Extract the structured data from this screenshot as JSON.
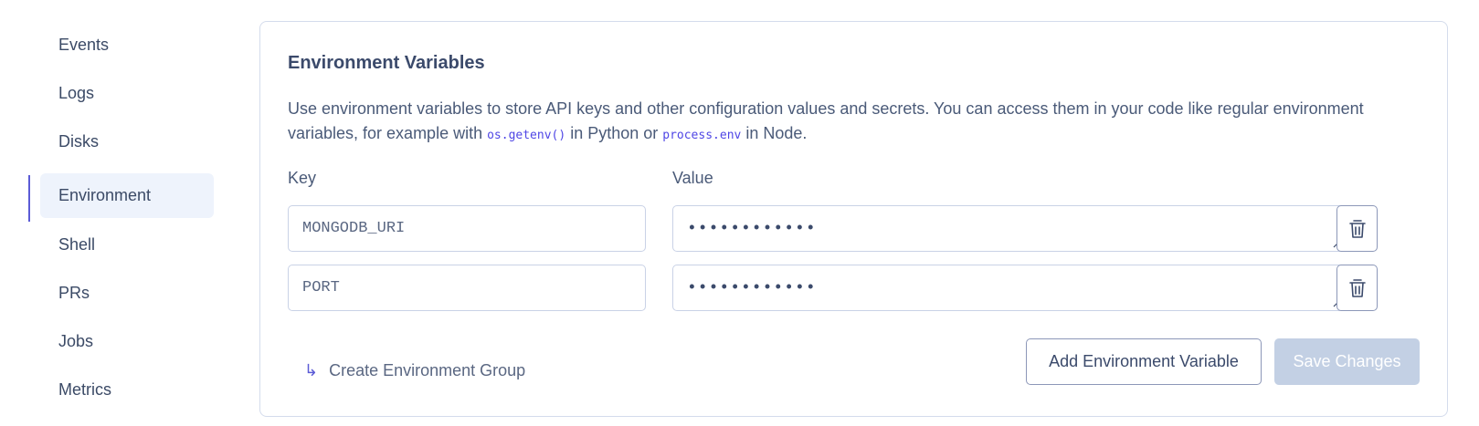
{
  "sidebar": {
    "items": [
      {
        "label": "Events"
      },
      {
        "label": "Logs"
      },
      {
        "label": "Disks"
      },
      {
        "label": "Environment",
        "active": true
      },
      {
        "label": "Shell"
      },
      {
        "label": "PRs"
      },
      {
        "label": "Jobs"
      },
      {
        "label": "Metrics"
      }
    ]
  },
  "env": {
    "title": "Environment Variables",
    "desc_part1": "Use environment variables to store API keys and other configuration values and secrets. You can access them in your code like regular environment variables, for example with ",
    "code1": "os.getenv()",
    "desc_part2": " in Python or ",
    "code2": "process.env",
    "desc_part3": " in Node.",
    "key_label": "Key",
    "value_label": "Value",
    "rows": [
      {
        "key": "MONGODB_URI",
        "value": "••••••••••••"
      },
      {
        "key": "PORT",
        "value": "••••••••••••"
      }
    ],
    "create_group_label": "Create Environment Group",
    "add_label": "Add Environment Variable",
    "save_label": "Save Changes"
  },
  "colors": {
    "accent": "#5b5bd6",
    "active_bg": "#eef3fc",
    "disabled_button": "#c3d0e4"
  },
  "icons": {
    "trash": "trash-icon",
    "create_arrow": "corner-down-right-icon"
  }
}
